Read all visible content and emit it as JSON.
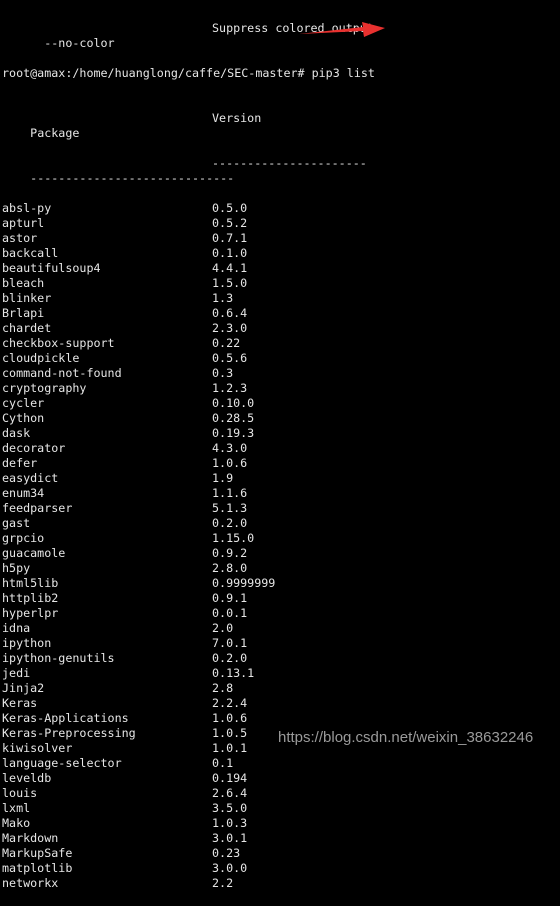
{
  "terminal": {
    "prev_option": {
      "flag": "  --no-color",
      "desc": "Suppress colored output"
    },
    "prompt": "root@amax:/home/huanglong/caffe/SEC-master# pip3 list",
    "header": {
      "package": "Package",
      "version": "Version"
    },
    "separator": {
      "package": "-----------------------------",
      "version": "----------------------"
    },
    "packages": [
      [
        "absl-py",
        "0.5.0"
      ],
      [
        "apturl",
        "0.5.2"
      ],
      [
        "astor",
        "0.7.1"
      ],
      [
        "backcall",
        "0.1.0"
      ],
      [
        "beautifulsoup4",
        "4.4.1"
      ],
      [
        "bleach",
        "1.5.0"
      ],
      [
        "blinker",
        "1.3"
      ],
      [
        "Brlapi",
        "0.6.4"
      ],
      [
        "chardet",
        "2.3.0"
      ],
      [
        "checkbox-support",
        "0.22"
      ],
      [
        "cloudpickle",
        "0.5.6"
      ],
      [
        "command-not-found",
        "0.3"
      ],
      [
        "cryptography",
        "1.2.3"
      ],
      [
        "cycler",
        "0.10.0"
      ],
      [
        "Cython",
        "0.28.5"
      ],
      [
        "dask",
        "0.19.3"
      ],
      [
        "decorator",
        "4.3.0"
      ],
      [
        "defer",
        "1.0.6"
      ],
      [
        "easydict",
        "1.9"
      ],
      [
        "enum34",
        "1.1.6"
      ],
      [
        "feedparser",
        "5.1.3"
      ],
      [
        "gast",
        "0.2.0"
      ],
      [
        "grpcio",
        "1.15.0"
      ],
      [
        "guacamole",
        "0.9.2"
      ],
      [
        "h5py",
        "2.8.0"
      ],
      [
        "html5lib",
        "0.9999999"
      ],
      [
        "httplib2",
        "0.9.1"
      ],
      [
        "hyperlpr",
        "0.0.1"
      ],
      [
        "idna",
        "2.0"
      ],
      [
        "ipython",
        "7.0.1"
      ],
      [
        "ipython-genutils",
        "0.2.0"
      ],
      [
        "jedi",
        "0.13.1"
      ],
      [
        "Jinja2",
        "2.8"
      ],
      [
        "Keras",
        "2.2.4"
      ],
      [
        "Keras-Applications",
        "1.0.6"
      ],
      [
        "Keras-Preprocessing",
        "1.0.5"
      ],
      [
        "kiwisolver",
        "1.0.1"
      ],
      [
        "language-selector",
        "0.1"
      ],
      [
        "leveldb",
        "0.194"
      ],
      [
        "louis",
        "2.6.4"
      ],
      [
        "lxml",
        "3.5.0"
      ],
      [
        "Mako",
        "1.0.3"
      ],
      [
        "Markdown",
        "3.0.1"
      ],
      [
        "MarkupSafe",
        "0.23"
      ],
      [
        "matplotlib",
        "3.0.0"
      ],
      [
        "networkx",
        "2.2"
      ]
    ]
  },
  "annotation": {
    "arrow_color": "#e8312f",
    "icon": "arrow-right-icon"
  },
  "watermark": "https://blog.csdn.net/weixin_38632246"
}
